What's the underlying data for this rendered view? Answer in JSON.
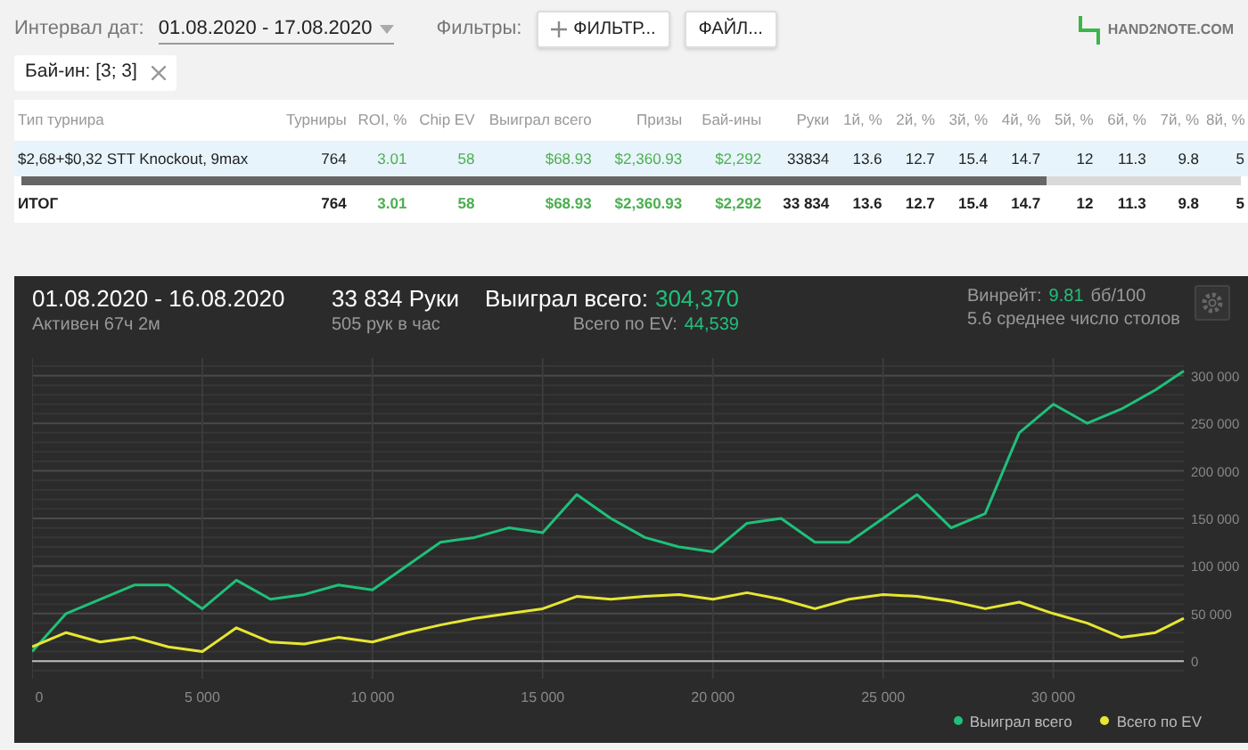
{
  "toolbar": {
    "date_label": "Интервал дат:",
    "date_value": "01.08.2020 - 17.08.2020",
    "filters_label": "Фильтры:",
    "buttons": [
      {
        "label": "ФИЛЬТР..."
      },
      {
        "label": "ФАЙЛ..."
      }
    ],
    "logo": "HAND2NOTE.COM"
  },
  "active_filters": [
    {
      "label": "Бай-ин: [3; 3]"
    }
  ],
  "table": {
    "columns": [
      {
        "label": "Тип турнира"
      },
      {
        "label": "Турниры"
      },
      {
        "label": "ROI, %",
        "color": "#4caf50"
      },
      {
        "label": "Chip EV",
        "color": "#4caf50"
      },
      {
        "label": "Выиграл всего",
        "color": "#4caf50"
      },
      {
        "label": "Призы",
        "color": "#4caf50"
      },
      {
        "label": "Бай-ины",
        "color": "#4caf50"
      },
      {
        "label": "Руки"
      },
      {
        "label": "1й, %"
      },
      {
        "label": "2й, %"
      },
      {
        "label": "3й, %"
      },
      {
        "label": "4й, %"
      },
      {
        "label": "5й, %"
      },
      {
        "label": "6й, %"
      },
      {
        "label": "7й, %"
      },
      {
        "label": "8й, %"
      }
    ],
    "rows": [
      {
        "kind": "data",
        "selected": true,
        "cells": [
          "$2,68+$0,32 STT Knockout, 9max",
          "764",
          "3.01",
          "58",
          "$68.93",
          "$2,360.93",
          "$2,292",
          "33834",
          "13.6",
          "12.7",
          "15.4",
          "14.7",
          "12",
          "11.3",
          "9.8",
          "5"
        ]
      },
      {
        "kind": "total",
        "selected": false,
        "cells": [
          "ИТОГ",
          "764",
          "3.01",
          "58",
          "$68.93",
          "$2,360.93",
          "$2,292",
          "33 834",
          "13.6",
          "12.7",
          "15.4",
          "14.7",
          "12",
          "11.3",
          "9.8",
          "5"
        ]
      }
    ]
  },
  "summary": {
    "period": "01.08.2020 - 16.08.2020",
    "active": "Активен 67ч 2м",
    "hands": "33 834 Руки",
    "rate": "505 рук в час",
    "won_label": "Выиграл всего:",
    "won_value": "304,370",
    "ev_label": "Всего по EV:",
    "ev_value": "44,539",
    "winrate_label": "Винрейт:",
    "winrate_value": "9.81",
    "winrate_unit": "бб/100",
    "tables": "5.6 среднее число столов"
  },
  "chart_data": {
    "type": "line",
    "x": [
      0,
      1000,
      2000,
      3000,
      4000,
      5000,
      6000,
      7000,
      8000,
      9000,
      10000,
      11000,
      12000,
      13000,
      14000,
      15000,
      16000,
      17000,
      18000,
      19000,
      20000,
      21000,
      22000,
      23000,
      24000,
      25000,
      26000,
      27000,
      28000,
      29000,
      30000,
      31000,
      32000,
      33000,
      33834
    ],
    "series": [
      {
        "name": "Выиграл всего",
        "color": "#1fc07a",
        "values": [
          10000,
          50000,
          65000,
          80000,
          80000,
          55000,
          85000,
          65000,
          70000,
          80000,
          75000,
          100000,
          125000,
          130000,
          140000,
          135000,
          175000,
          150000,
          130000,
          120000,
          115000,
          145000,
          150000,
          125000,
          125000,
          150000,
          175000,
          140000,
          155000,
          240000,
          270000,
          250000,
          265000,
          285000,
          305000
        ]
      },
      {
        "name": "Всего по EV",
        "color": "#e6e633",
        "values": [
          15000,
          30000,
          20000,
          25000,
          15000,
          10000,
          35000,
          20000,
          18000,
          25000,
          20000,
          30000,
          38000,
          45000,
          50000,
          55000,
          68000,
          65000,
          68000,
          70000,
          65000,
          72000,
          65000,
          55000,
          65000,
          70000,
          68000,
          63000,
          55000,
          62000,
          50000,
          40000,
          25000,
          30000,
          45000
        ]
      }
    ],
    "grid": true,
    "xlim": [
      0,
      33834
    ],
    "ylim": [
      -18500,
      318500
    ],
    "xticks": [
      0,
      {
        "value": 5000,
        "label": "5 000"
      },
      {
        "value": 10000,
        "label": "10 000"
      },
      {
        "value": 15000,
        "label": "15 000"
      },
      {
        "value": 20000,
        "label": "20 000"
      },
      {
        "value": 25000,
        "label": "25 000"
      },
      {
        "value": 30000,
        "label": "30 000"
      }
    ],
    "yticks": [
      0,
      {
        "value": 50000,
        "label": "50 000"
      },
      {
        "value": 100000,
        "label": "100 000"
      },
      {
        "value": 150000,
        "label": "150 000"
      },
      {
        "value": 200000,
        "label": "200 000"
      },
      {
        "value": 250000,
        "label": "250 000"
      },
      {
        "value": 300000,
        "label": "300 000"
      }
    ]
  }
}
